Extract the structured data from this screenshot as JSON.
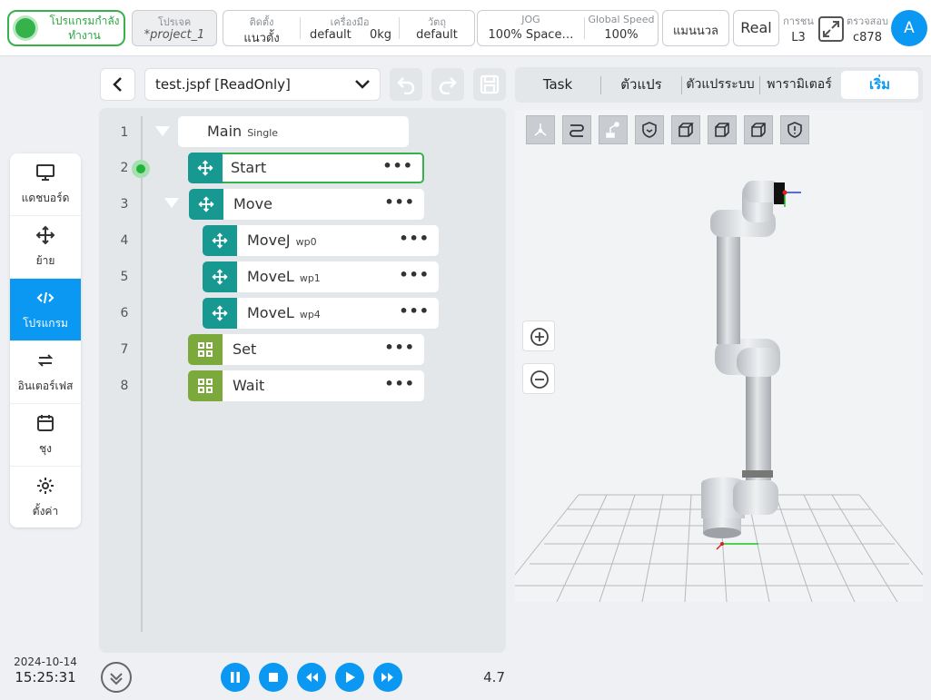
{
  "topbar": {
    "status": "โปรแกรมกำลังทำงาน",
    "project_label": "โปรเจค",
    "project_value": "*project_1",
    "install_label": "ติดตั้ง",
    "install_value": "แนวตั้ง",
    "tool_label": "เครื่องมือ",
    "tool_value": "default",
    "tool_weight": "0kg",
    "payload_label": "วัตถุ",
    "payload_value": "default",
    "jog_label": "JOG",
    "jog_value": "100%  Space…",
    "speed_label": "Global Speed",
    "speed_value": "100%",
    "manual_label": "แมนนวล",
    "real_label": "Real",
    "collision_label": "การชน",
    "collision_value": "L3",
    "check_label": "ตรวจสอบ",
    "check_value": "c878",
    "avatar_letter": "A"
  },
  "nav": [
    {
      "label": "แดชบอร์ด",
      "icon": "monitor-icon"
    },
    {
      "label": "ย้าย",
      "icon": "move-icon"
    },
    {
      "label": "โปรแกรม",
      "icon": "code-icon",
      "active": true
    },
    {
      "label": "อินเตอร์เฟส",
      "icon": "swap-icon"
    },
    {
      "label": "ชุง",
      "icon": "calendar-icon"
    },
    {
      "label": "ตั้งค่า",
      "icon": "gear-icon"
    }
  ],
  "clock": {
    "date": "2024-10-14",
    "time": "15:25:31"
  },
  "editor": {
    "file_name": "test.jspf [ReadOnly]",
    "version": "4.7"
  },
  "tree": [
    {
      "line": "1",
      "name": "Main",
      "tag": "Single"
    },
    {
      "line": "2",
      "name": "Start",
      "tag": ""
    },
    {
      "line": "3",
      "name": "Move",
      "tag": ""
    },
    {
      "line": "4",
      "name": "MoveJ",
      "tag": "wp0"
    },
    {
      "line": "5",
      "name": "MoveL",
      "tag": "wp1"
    },
    {
      "line": "6",
      "name": "MoveL",
      "tag": "wp4"
    },
    {
      "line": "7",
      "name": "Set",
      "tag": ""
    },
    {
      "line": "8",
      "name": "Wait",
      "tag": ""
    }
  ],
  "tabs": [
    {
      "label": "Task"
    },
    {
      "label": "ตัวแปร"
    },
    {
      "label": "ตัวแปรระบบ"
    },
    {
      "label": "พารามิเตอร์"
    },
    {
      "label": "เริ่ม",
      "active": true
    }
  ],
  "colors": {
    "accent": "#0a98f2",
    "running": "#35b34a",
    "move_node": "#179992",
    "logic_node": "#7ca93c"
  }
}
